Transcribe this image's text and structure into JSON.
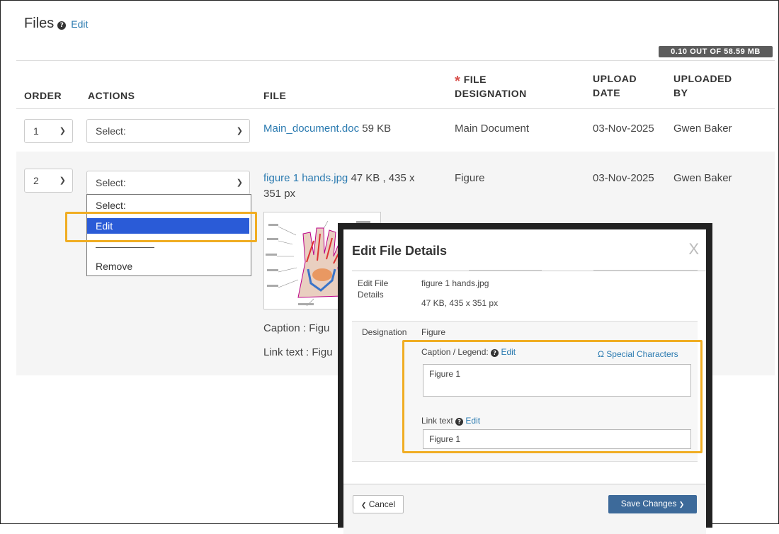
{
  "header": {
    "title": "Files",
    "edit_label": "Edit"
  },
  "quota": "0.10 OUT OF 58.59 MB",
  "columns": {
    "order": "ORDER",
    "actions": "ACTIONS",
    "file": "FILE",
    "designation_line1": "FILE",
    "designation_line2": "DESIGNATION",
    "upload_date_line1": "UPLOAD",
    "upload_date_line2": "DATE",
    "uploaded_by_line1": "UPLOADED",
    "uploaded_by_line2": "BY"
  },
  "rows": [
    {
      "order": "1",
      "action": "Select:",
      "file_name": "Main_document.doc",
      "file_meta": "59 KB",
      "designation": "Main Document",
      "upload_date": "03-Nov-2025",
      "uploaded_by": "Gwen Baker"
    },
    {
      "order": "2",
      "action": "Select:",
      "file_name": "figure 1 hands.jpg",
      "file_meta": "47 KB , 435 x",
      "file_meta2": "351 px",
      "designation": "Figure",
      "upload_date": "03-Nov-2025",
      "uploaded_by": "Gwen Baker",
      "caption_prefix": "Caption : Figu",
      "link_prefix": "Link text : Figu"
    }
  ],
  "dropdown": {
    "items": [
      "Select:",
      "Edit",
      "Remove"
    ],
    "selected": "Edit"
  },
  "modal": {
    "title": "Edit File Details",
    "close": "X",
    "details_label_1": "Edit File",
    "details_label_2": "Details",
    "file_name": "figure 1 hands.jpg",
    "file_info": "47 KB, 435 x 351 px",
    "designation_label": "Designation",
    "designation_value": "Figure",
    "caption_label": "Caption / Legend:",
    "caption_edit": "Edit",
    "special_chars": "Ω Special Characters",
    "caption_value": "Figure 1",
    "link_label": "Link text",
    "link_edit": "Edit",
    "link_value": "Figure 1",
    "cancel": "Cancel",
    "save": "Save Changes"
  },
  "colors": {
    "link": "#2a7ab0",
    "highlight": "#f0ad23",
    "dropdown_active": "#2a5bd7",
    "save_button": "#3d6a9a"
  }
}
